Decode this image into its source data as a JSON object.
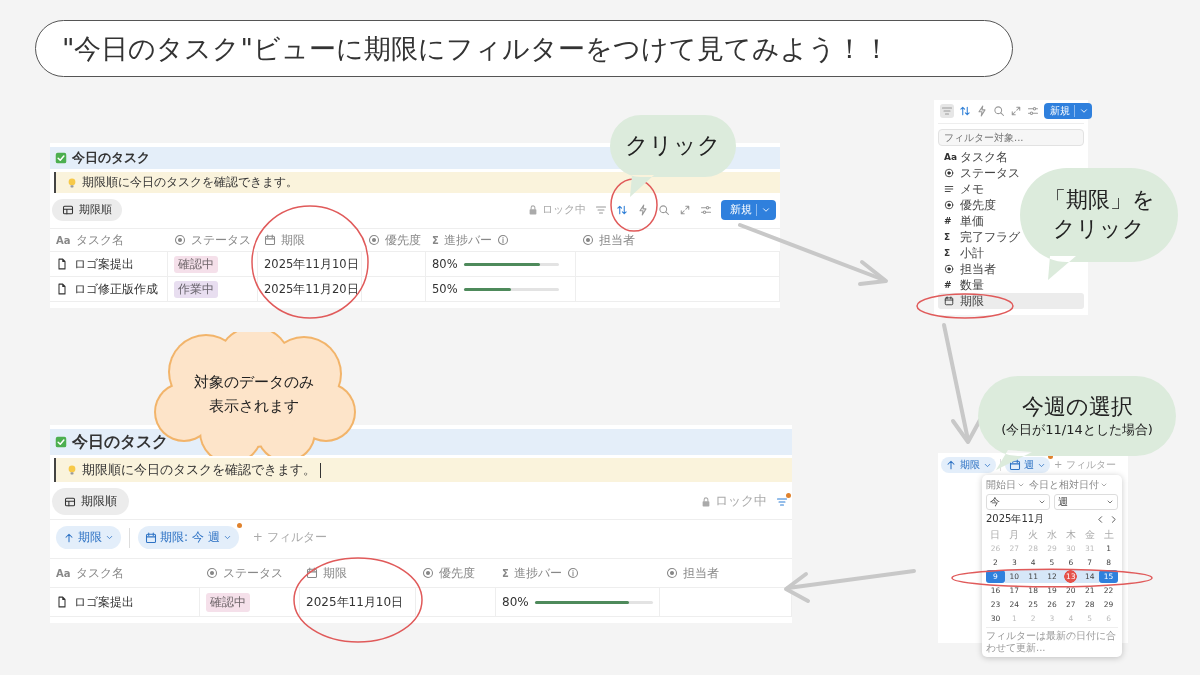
{
  "title": "\"今日のタスク\"ビューに期限にフィルターをつけて見てみよう！！",
  "before_view": {
    "heading": "今日のタスク",
    "callout": "期限順に今日のタスクを確認できます。",
    "view_tab": "期限順",
    "toolbar": [
      {
        "kind": "lock",
        "label": "ロック中"
      },
      {
        "kind": "filter",
        "active": false
      },
      {
        "kind": "sort",
        "active": true
      },
      {
        "kind": "bolt"
      },
      {
        "kind": "search"
      },
      {
        "kind": "expand"
      },
      {
        "kind": "sliders"
      },
      {
        "kind": "new",
        "label": "新規"
      }
    ],
    "columns": [
      {
        "label": "タスク名",
        "kind": "text",
        "glyph": "Aa"
      },
      {
        "label": "ステータス",
        "kind": "select"
      },
      {
        "label": "期限",
        "kind": "date"
      },
      {
        "label": "優先度",
        "kind": "select"
      },
      {
        "label": "進捗バー",
        "kind": "formula",
        "glyph": "Σ",
        "info": true
      },
      {
        "label": "担当者",
        "kind": "select"
      }
    ],
    "rows": [
      {
        "name": "ロゴ案提出",
        "status": "確認中",
        "color": "#f5e0ea",
        "due": "2025年11月10日",
        "progress": "80%",
        "level": 0.8
      },
      {
        "name": "ロゴ修正版作成",
        "status": "作業中",
        "color": "#e8def0",
        "due": "2025年11月20日",
        "progress": "50%",
        "level": 0.5
      }
    ]
  },
  "filter_menu": {
    "toolbar": [
      {
        "kind": "filter",
        "pressed": true
      },
      {
        "kind": "sort",
        "active": true
      },
      {
        "kind": "bolt"
      },
      {
        "kind": "search"
      },
      {
        "kind": "expand"
      },
      {
        "kind": "sliders"
      },
      {
        "kind": "new",
        "label": "新規"
      }
    ],
    "placeholder": "フィルター対象...",
    "items": [
      {
        "label": "タスク名",
        "kind": "text",
        "glyph": "Aa",
        "selected": false
      },
      {
        "label": "ステータス",
        "kind": "select",
        "selected": false
      },
      {
        "label": "メモ",
        "kind": "lines",
        "selected": false
      },
      {
        "label": "優先度",
        "kind": "select",
        "selected": false
      },
      {
        "label": "単価",
        "kind": "number",
        "glyph": "#",
        "selected": false
      },
      {
        "label": "完了フラグ",
        "kind": "formula",
        "glyph": "Σ",
        "selected": false
      },
      {
        "label": "小計",
        "kind": "formula",
        "glyph": "Σ",
        "selected": false
      },
      {
        "label": "担当者",
        "kind": "select",
        "selected": false
      },
      {
        "label": "数量",
        "kind": "number",
        "glyph": "#",
        "selected": false
      },
      {
        "label": "期限",
        "kind": "date",
        "selected": true
      }
    ]
  },
  "date_picker": {
    "chips": [
      {
        "kind": "sort",
        "label": "期限"
      },
      {
        "kind": "filter",
        "label": "週",
        "dot": true
      }
    ],
    "add_filter": "+ フィルター",
    "popup": {
      "field": "開始日",
      "mode": "今日と相対日付",
      "selects": [
        "今",
        "週"
      ],
      "month": "2025年11月",
      "weekdays": [
        "日",
        "月",
        "火",
        "水",
        "木",
        "金",
        "土"
      ],
      "weeks": [
        [
          {
            "d": "26",
            "kind": "other"
          },
          {
            "d": "27",
            "kind": "other"
          },
          {
            "d": "28",
            "kind": "other"
          },
          {
            "d": "29",
            "kind": "other"
          },
          {
            "d": "30",
            "kind": "other"
          },
          {
            "d": "31",
            "kind": "other"
          },
          {
            "d": "1",
            "kind": "day"
          }
        ],
        [
          {
            "d": "2",
            "kind": "day"
          },
          {
            "d": "3",
            "kind": "day"
          },
          {
            "d": "4",
            "kind": "day"
          },
          {
            "d": "5",
            "kind": "day"
          },
          {
            "d": "6",
            "kind": "day"
          },
          {
            "d": "7",
            "kind": "day"
          },
          {
            "d": "8",
            "kind": "day"
          }
        ],
        [
          {
            "d": "9",
            "kind": "edge"
          },
          {
            "d": "10",
            "kind": "range"
          },
          {
            "d": "11",
            "kind": "range"
          },
          {
            "d": "12",
            "kind": "range"
          },
          {
            "d": "13",
            "kind": "today"
          },
          {
            "d": "14",
            "kind": "range"
          },
          {
            "d": "15",
            "kind": "edge"
          }
        ],
        [
          {
            "d": "16",
            "kind": "day"
          },
          {
            "d": "17",
            "kind": "day"
          },
          {
            "d": "18",
            "kind": "day"
          },
          {
            "d": "19",
            "kind": "day"
          },
          {
            "d": "20",
            "kind": "day"
          },
          {
            "d": "21",
            "kind": "day"
          },
          {
            "d": "22",
            "kind": "day"
          }
        ],
        [
          {
            "d": "23",
            "kind": "day"
          },
          {
            "d": "24",
            "kind": "day"
          },
          {
            "d": "25",
            "kind": "day"
          },
          {
            "d": "26",
            "kind": "day"
          },
          {
            "d": "27",
            "kind": "day"
          },
          {
            "d": "28",
            "kind": "day"
          },
          {
            "d": "29",
            "kind": "day"
          }
        ],
        [
          {
            "d": "30",
            "kind": "day"
          },
          {
            "d": "1",
            "kind": "other"
          },
          {
            "d": "2",
            "kind": "other"
          },
          {
            "d": "3",
            "kind": "other"
          },
          {
            "d": "4",
            "kind": "other"
          },
          {
            "d": "5",
            "kind": "other"
          },
          {
            "d": "6",
            "kind": "other"
          }
        ]
      ],
      "footer": "フィルターは最新の日付に合わせて更新..."
    }
  },
  "after_view": {
    "heading": "今日のタスク",
    "callout": "期限順に今日のタスクを確認できます。",
    "view_tab": "期限順",
    "toolbar": [
      {
        "kind": "lock",
        "label": "ロック中"
      },
      {
        "kind": "filter",
        "active": true,
        "dot": true
      }
    ],
    "chips": [
      {
        "kind": "sort",
        "label": "期限"
      },
      {
        "kind": "filter",
        "label": "期限: 今 週",
        "dot": true
      }
    ],
    "add_filter": "+ フィルター",
    "columns": [
      {
        "label": "タスク名",
        "kind": "text",
        "glyph": "Aa"
      },
      {
        "label": "ステータス",
        "kind": "select"
      },
      {
        "label": "期限",
        "kind": "date"
      },
      {
        "label": "優先度",
        "kind": "select"
      },
      {
        "label": "進捗バー",
        "kind": "formula",
        "glyph": "Σ",
        "info": true
      },
      {
        "label": "担当者",
        "kind": "select"
      }
    ],
    "rows": [
      {
        "name": "ロゴ案提出",
        "status": "確認中",
        "color": "#f5e0ea",
        "due": "2025年11月10日",
        "progress": "80%",
        "level": 0.8
      }
    ]
  },
  "annotations": [
    {
      "kind": "bubble",
      "lines": [
        "クリック"
      ]
    },
    {
      "kind": "bubble",
      "lines": [
        "「期限」を",
        "クリック"
      ]
    },
    {
      "kind": "bubble",
      "lines": [
        "今週の選択"
      ],
      "note": "(今日が11/14とした場合)"
    },
    {
      "kind": "cloud",
      "lines": [
        "対象のデータのみ",
        "表示されます"
      ]
    }
  ]
}
